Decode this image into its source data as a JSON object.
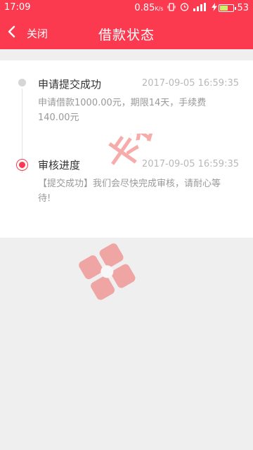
{
  "status_bar": {
    "time": "17:09",
    "network_speed": "0.85",
    "network_unit": "K/s",
    "battery_level": "53"
  },
  "nav": {
    "back_label": "关闭",
    "title": "借款状态"
  },
  "timeline": [
    {
      "title": "申请提交成功",
      "time": "2017-09-05 16:59:35",
      "desc": "申请借款1000.00元，期限14天，手续费140.00元"
    },
    {
      "title": "审核进度",
      "time": "2017-09-05 16:59:35",
      "desc": "【提交成功】我们会尽快完成审核，请耐心等待!"
    }
  ],
  "watermark": {
    "text": "卡农社区"
  },
  "colors": {
    "brand": "#fb3a50",
    "background": "#efefef"
  }
}
